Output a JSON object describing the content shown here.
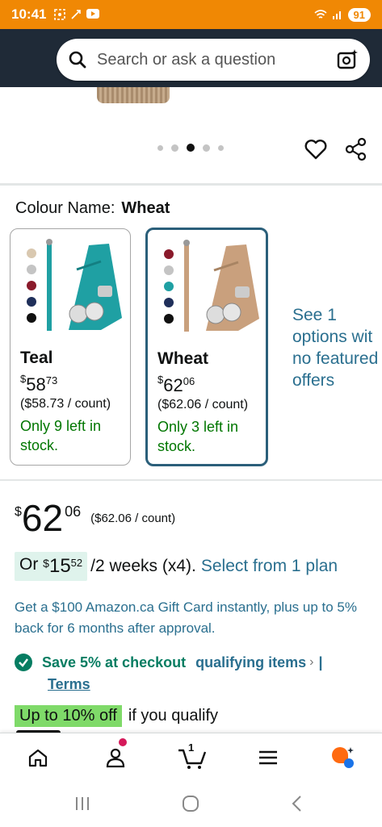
{
  "status_bar": {
    "time": "10:41",
    "battery": "91",
    "icons_left": [
      "screenshot-icon",
      "cast-icon",
      "youtube-icon"
    ],
    "icons_right": [
      "wifi-icon",
      "signal-icon"
    ]
  },
  "search": {
    "placeholder": "Search or ask a question"
  },
  "gallery": {
    "dot_count": 5,
    "active_dot": 3
  },
  "colour": {
    "label": "Colour Name:",
    "selected": "Wheat"
  },
  "swatches": [
    {
      "name": "Teal",
      "price_symbol": "$",
      "price_whole": "58",
      "price_cents": "73",
      "unit_price": "($58.73 / count)",
      "stock": "Only 9 left in stock.",
      "strap_color": "#1fa0a3"
    },
    {
      "name": "Wheat",
      "price_symbol": "$",
      "price_whole": "62",
      "price_cents": "06",
      "unit_price": "($62.06 / count)",
      "stock": "Only 3 left in stock.",
      "strap_color": "#c9a07d"
    }
  ],
  "see_options": {
    "line1": "See 1",
    "line2": "options wit",
    "line3": "no featured",
    "line4": "offers"
  },
  "price": {
    "symbol": "$",
    "whole": "62",
    "cents": "06",
    "unit": "($62.06 / count)"
  },
  "plan": {
    "prefix": "Or",
    "symbol": "$",
    "whole": "15",
    "cents": "52",
    "period": "/2 weeks (x4).",
    "link": "Select from 1 plan"
  },
  "gift_card_text": "Get a $100 Amazon.ca Gift Card instantly, plus up to 5% back for 6 months after approval.",
  "save": {
    "text": "Save 5% at checkout",
    "link": "qualifying items",
    "chevron": "›",
    "separator": "|",
    "terms": "Terms"
  },
  "promo": {
    "badge": "Up to 10% off",
    "rest": "if you qualify"
  },
  "bottom_nav": {
    "cart_count": "1",
    "items": [
      "home-icon",
      "account-icon",
      "cart-icon",
      "menu-icon",
      "rufus-icon"
    ]
  },
  "colors": {
    "status_bar": "#f08804",
    "header": "#1f2a37",
    "link": "#2a6f8f",
    "stock_green": "#007600",
    "selected_border": "#2b5f7a",
    "promo_badge": "#7fda69",
    "plan_pill": "#dff3ec"
  }
}
